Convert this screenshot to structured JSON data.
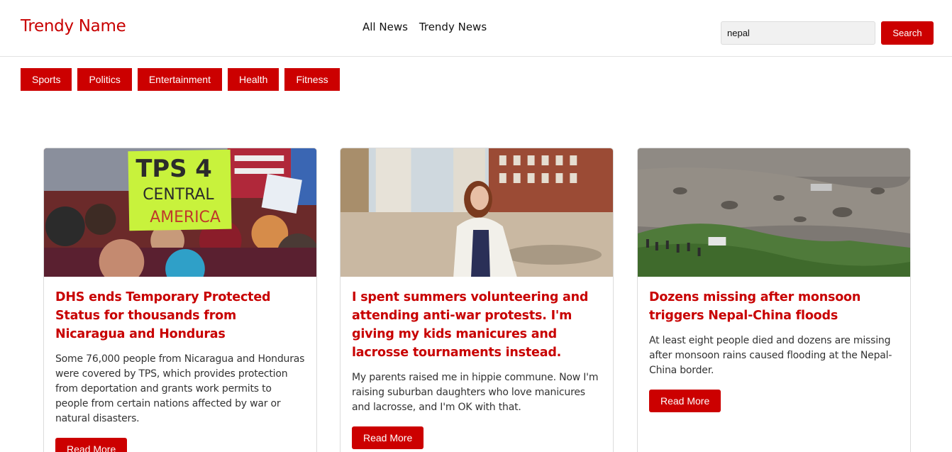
{
  "header": {
    "logo": "Trendy Name",
    "nav": [
      "All News",
      "Trendy News"
    ],
    "search": {
      "value": "nepal",
      "button_label": "Search"
    }
  },
  "categories": [
    "Sports",
    "Politics",
    "Entertainment",
    "Health",
    "Fitness"
  ],
  "articles": [
    {
      "title": "DHS ends Temporary Protected Status for thousands from Nicaragua and Honduras",
      "description": "Some 76,000 people from Nicaragua and Honduras were covered by TPS, which provides protection from deportation and grants work permits to people from certain nations affected by war or natural disasters.",
      "button_label": "Read More",
      "image_sign_lines": [
        "TPS 4",
        "CENTRAL",
        "AMERICA"
      ]
    },
    {
      "title": "I spent summers volunteering and attending anti-war protests. I'm giving my kids manicures and lacrosse tournaments instead.",
      "description": "My parents raised me in hippie commune. Now I'm raising suburban daughters who love manicures and lacrosse, and I'm OK with that.",
      "button_label": "Read More"
    },
    {
      "title": "Dozens missing after monsoon triggers Nepal-China floods",
      "description": "At least eight people died and dozens are missing after monsoon rains caused flooding at the Nepal-China border.",
      "button_label": "Read More"
    }
  ],
  "colors": {
    "brand": "#cc0000",
    "border": "#dcdcdc"
  }
}
